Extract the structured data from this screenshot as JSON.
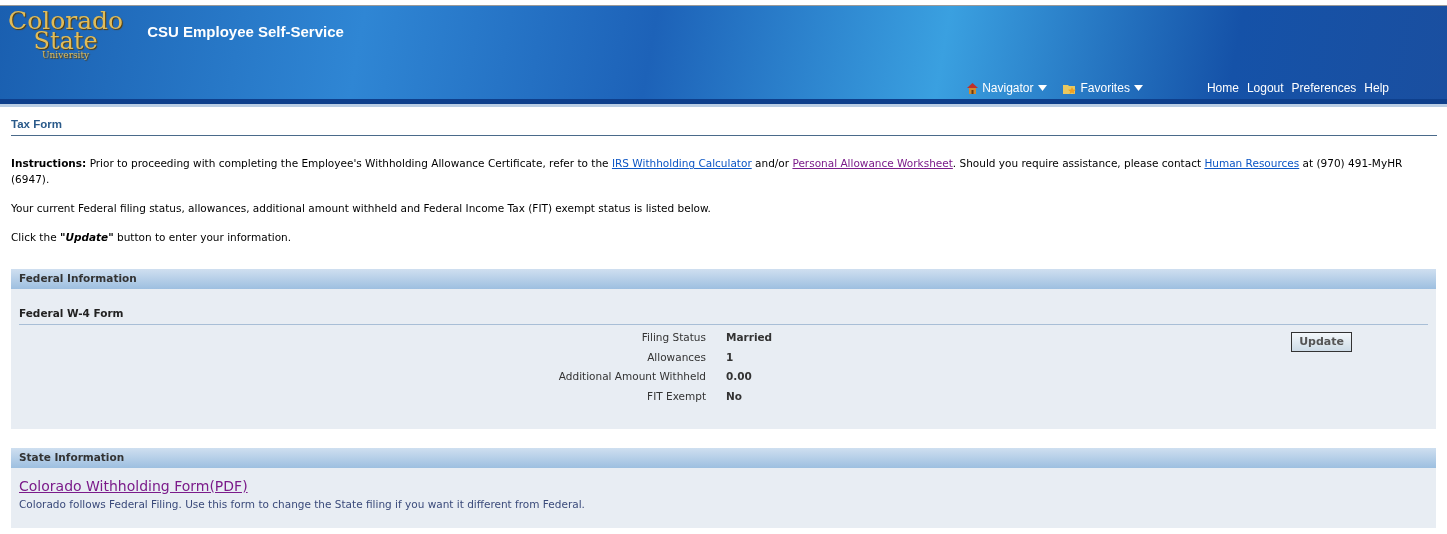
{
  "header": {
    "logo": {
      "line_1": "Colorado",
      "line_2": "State",
      "line_3": "University"
    },
    "title": "CSU Employee Self-Service",
    "menus": [
      {
        "label": "Navigator",
        "kind": "house"
      },
      {
        "label": "Favorites",
        "kind": "folder"
      }
    ],
    "links": [
      "Home",
      "Logout",
      "Preferences",
      "Help"
    ]
  },
  "page_title": "Tax Form",
  "instructions": [
    {
      "text": "**Instructions:** Prior to proceeding with completing the Employee's Withholding Allowance Certificate, refer to the "
    },
    {
      "text": "IRS Withholding Calculator",
      "link": true,
      "visited": false
    },
    {
      "text": " and/or "
    },
    {
      "text": "Personal Allowance Worksheet",
      "link": true,
      "visited": true
    },
    {
      "text": ". Should you require assistance, please contact "
    },
    {
      "text": "Human Resources",
      "link": true,
      "visited": false
    },
    {
      "text": " at (970) 491-MyHR (6947)."
    }
  ],
  "paragraphs": [
    "Your current Federal filing status, allowances, additional amount withheld and Federal Income Tax (FIT) exempt status is listed below.",
    "Click the **\"Update\"** button to enter your information."
  ],
  "federal": {
    "header": "Federal Information",
    "subheader": "Federal W-4 Form",
    "fields": [
      {
        "label": "Filing Status",
        "value": "Married"
      },
      {
        "label": "Allowances",
        "value": "1"
      },
      {
        "label": "Additional Amount Withheld",
        "value": "0.00"
      },
      {
        "label": "FIT Exempt",
        "value": "No"
      }
    ],
    "button": "Update"
  },
  "state": {
    "header": "State Information",
    "link": {
      "text": "Colorado Withholding Form(PDF)",
      "visited": true
    },
    "note": "Colorado follows Federal Filing. Use this form to change the State filing if you want it different from Federal."
  }
}
